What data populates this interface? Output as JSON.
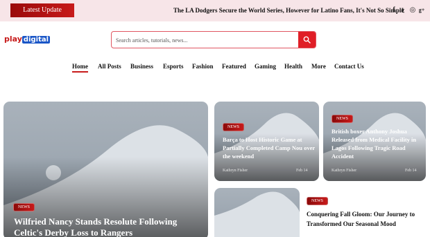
{
  "topbar": {
    "latest_label": "Latest Update",
    "headline": "The LA Dodgers Secure the World Series, However for Latino Fans, It's Not So Simple",
    "social": [
      "f",
      "𝕥",
      "◎",
      "g+"
    ]
  },
  "logo": {
    "part1": "play",
    "part2": "digital"
  },
  "search": {
    "placeholder": "Search articles, tutorials, news..."
  },
  "nav": [
    "Home",
    "All Posts",
    "Business",
    "Esports",
    "Fashion",
    "Featured",
    "Gaming",
    "Health",
    "More",
    "Contact Us"
  ],
  "colors": {
    "accent": "#c71a1a",
    "topbar_bg": "#f7e5e8",
    "search_btn": "#e01e26",
    "brand_blue": "#1a56c7"
  },
  "posts": {
    "main": {
      "badge": "NEWS",
      "title": "Wilfried Nancy Stands Resolute Following Celtic's Derby Loss to Rangers"
    },
    "card1": {
      "badge": "NEWS",
      "title": "Barça to Host Historic Game at Partially Completed Camp Nou over the weekend",
      "author": "Kathryn Fisher",
      "date": "Feb 14"
    },
    "card2": {
      "badge": "NEWS",
      "title": "British boxer Anthony Joshua Released from Medical Facility in Lagos Following Tragic Road Accident",
      "author": "Kathryn Fisher",
      "date": "Feb 14"
    },
    "side": {
      "badge": "NEWS",
      "title": "Conquering Fall Gloom: Our Journey to Transformed Our Seasonal Mood"
    }
  }
}
